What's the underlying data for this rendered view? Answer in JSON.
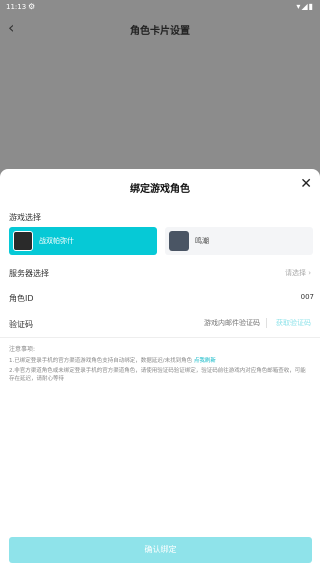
{
  "status_bar": {
    "time": "11:13",
    "gear_icon": "⚙",
    "right_icons": "▾◢▮"
  },
  "header": {
    "title": "角色卡片设置",
    "back_glyph": "‹"
  },
  "dialog": {
    "title": "绑定游戏角色",
    "close_glyph": "✕",
    "game_section_label": "游戏选择",
    "games": [
      {
        "name": "战双帕弥什",
        "selected": true
      },
      {
        "name": "鸣潮",
        "selected": false
      }
    ],
    "server_label": "服务器选择",
    "server_value": "请选择 ›",
    "role_id_label": "角色ID",
    "role_id_value": "007",
    "code_label": "验证码",
    "code_placeholder": "游戏内邮件验证码",
    "get_code_label": "获取验证码",
    "notes_title": "注意事项:",
    "note1_text": "1.已绑定登录手机的官方渠道游戏角色支持自动绑定，数据延迟/未找到角色",
    "note1_link": "点我刷新",
    "note2_text": "2.非官方渠道角色或未绑定登录手机的官方渠道角色，请使用验证码验证绑定，验证码前往游戏内对应角色邮箱查收，可能存在延迟，请耐心等待",
    "confirm_label": "确认绑定"
  },
  "colors": {
    "accent": "#06c9d6",
    "accent_disabled": "#8fe3ea",
    "overlay": "#8c8c8c"
  }
}
